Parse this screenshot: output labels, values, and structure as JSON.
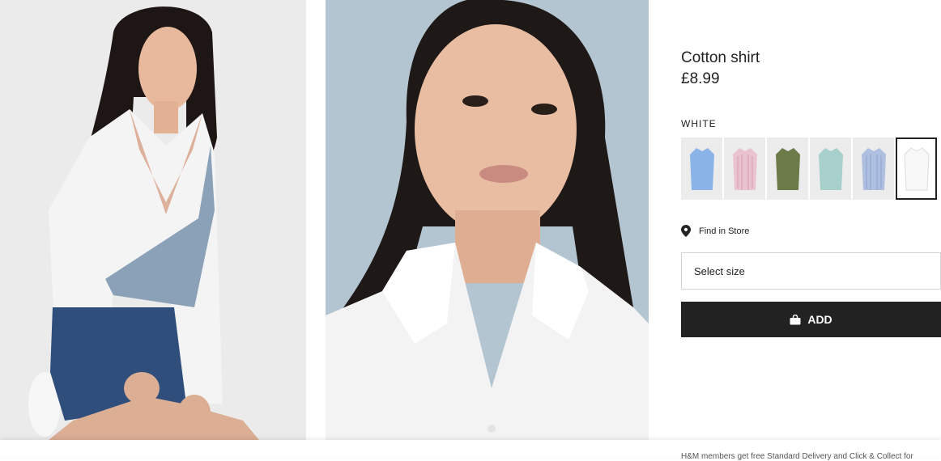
{
  "product": {
    "title": "Cotton shirt",
    "price": "£8.99",
    "color_label": "WHITE",
    "swatches": [
      {
        "name": "light-blue",
        "color": "#8ab4e8"
      },
      {
        "name": "pink-striped",
        "color": "#e9c3cf"
      },
      {
        "name": "khaki-green",
        "color": "#6d7a4a"
      },
      {
        "name": "mint",
        "color": "#a7cfcb"
      },
      {
        "name": "blue-striped",
        "color": "#aebfe0"
      },
      {
        "name": "white",
        "color": "#f8f8f8",
        "selected": true
      }
    ]
  },
  "find_store": {
    "label": "Find in Store"
  },
  "size_select": {
    "placeholder": "Select size"
  },
  "add_button": {
    "label": "ADD"
  },
  "footer_note": "H&M members get free Standard Delivery and Click & Collect for"
}
